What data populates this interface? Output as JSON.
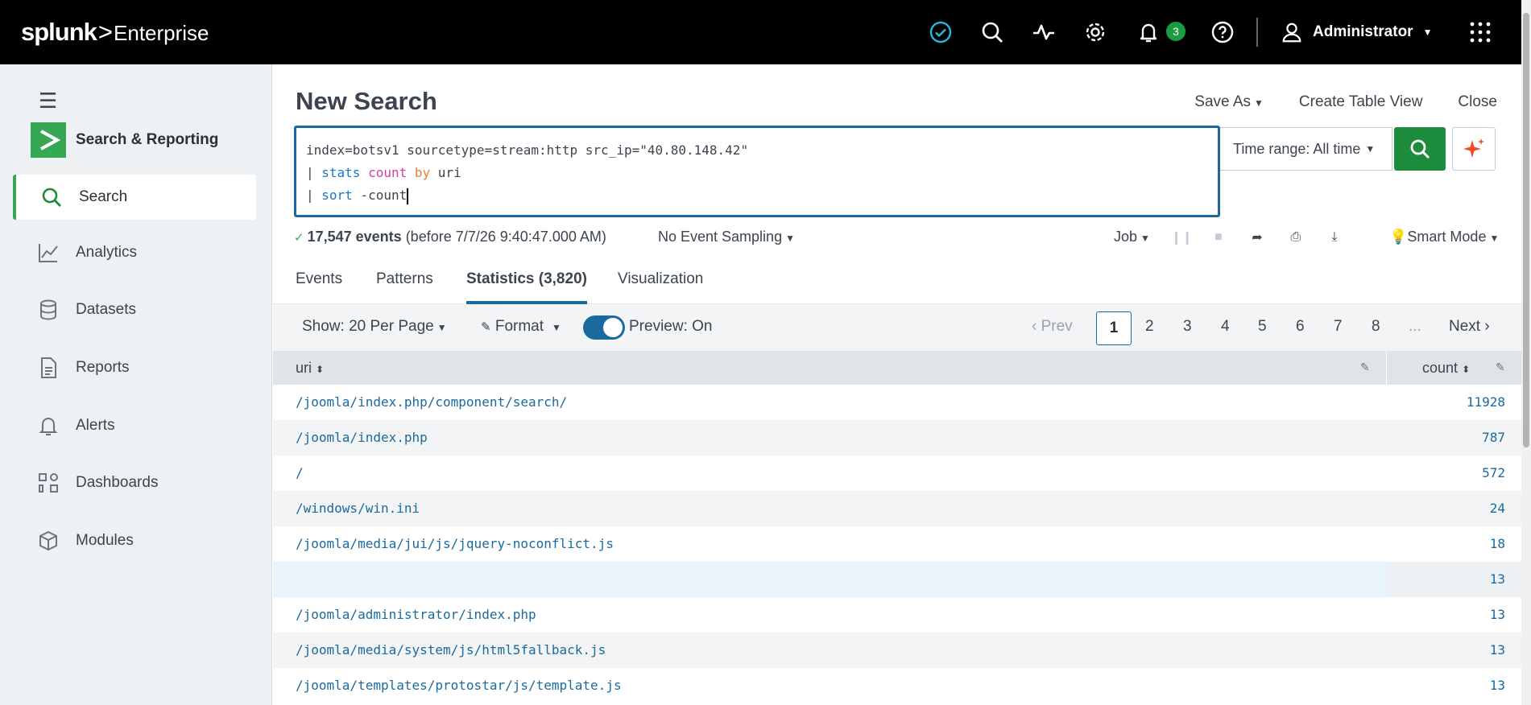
{
  "topbar": {
    "brand": "splunk",
    "brand_sep": ">",
    "product": "Enterprise",
    "notification_count": "3",
    "user_label": "Administrator",
    "accent_color": "#1a9c3e"
  },
  "sidebar": {
    "app_name": "Search & Reporting",
    "items": [
      {
        "label": "Search",
        "icon": "search-icon",
        "active": true
      },
      {
        "label": "Analytics",
        "icon": "analytics-icon"
      },
      {
        "label": "Datasets",
        "icon": "datasets-icon"
      },
      {
        "label": "Reports",
        "icon": "reports-icon"
      },
      {
        "label": "Alerts",
        "icon": "bell-icon"
      },
      {
        "label": "Dashboards",
        "icon": "dashboards-icon"
      },
      {
        "label": "Modules",
        "icon": "modules-icon"
      }
    ]
  },
  "header": {
    "title": "New Search",
    "save_as": "Save As",
    "create_table_view": "Create Table View",
    "close": "Close"
  },
  "search": {
    "line1": "index=botsv1 sourcetype=stream:http src_ip=\"40.80.148.42\"",
    "line2_pipe": "| ",
    "line2_cmd": "stats",
    "line2_fn": "count",
    "line2_by": "by",
    "line2_field": "uri",
    "line3_pipe": "| ",
    "line3_cmd": "sort",
    "line3_arg": "-count",
    "time_range": "Time range: All time"
  },
  "status": {
    "events": "17,547 events",
    "before": "(before 7/7/26 9:40:47.000 AM)",
    "sampling": "No Event Sampling",
    "job": "Job",
    "mode": "Smart Mode"
  },
  "tabs": [
    "Events",
    "Patterns",
    "Statistics (3,820)",
    "Visualization"
  ],
  "toolbar": {
    "show": "Show: 20 Per Page",
    "format": "Format",
    "preview": "Preview: On"
  },
  "pager": {
    "prev": "Prev",
    "pages": [
      "1",
      "2",
      "3",
      "4",
      "5",
      "6",
      "7",
      "8"
    ],
    "ellipsis": "...",
    "next": "Next"
  },
  "table": {
    "columns": [
      "uri",
      "count"
    ],
    "rows": [
      {
        "uri": "/joomla/index.php/component/search/",
        "count": "11928"
      },
      {
        "uri": "/joomla/index.php",
        "count": "787"
      },
      {
        "uri": "/",
        "count": "572"
      },
      {
        "uri": "/windows/win.ini",
        "count": "24"
      },
      {
        "uri": "/joomla/media/jui/js/jquery-noconflict.js",
        "count": "18"
      },
      {
        "uri": "",
        "count": "13"
      },
      {
        "uri": "/joomla/administrator/index.php",
        "count": "13"
      },
      {
        "uri": "/joomla/media/system/js/html5fallback.js",
        "count": "13"
      },
      {
        "uri": "/joomla/templates/protostar/js/template.js",
        "count": "13"
      }
    ]
  }
}
